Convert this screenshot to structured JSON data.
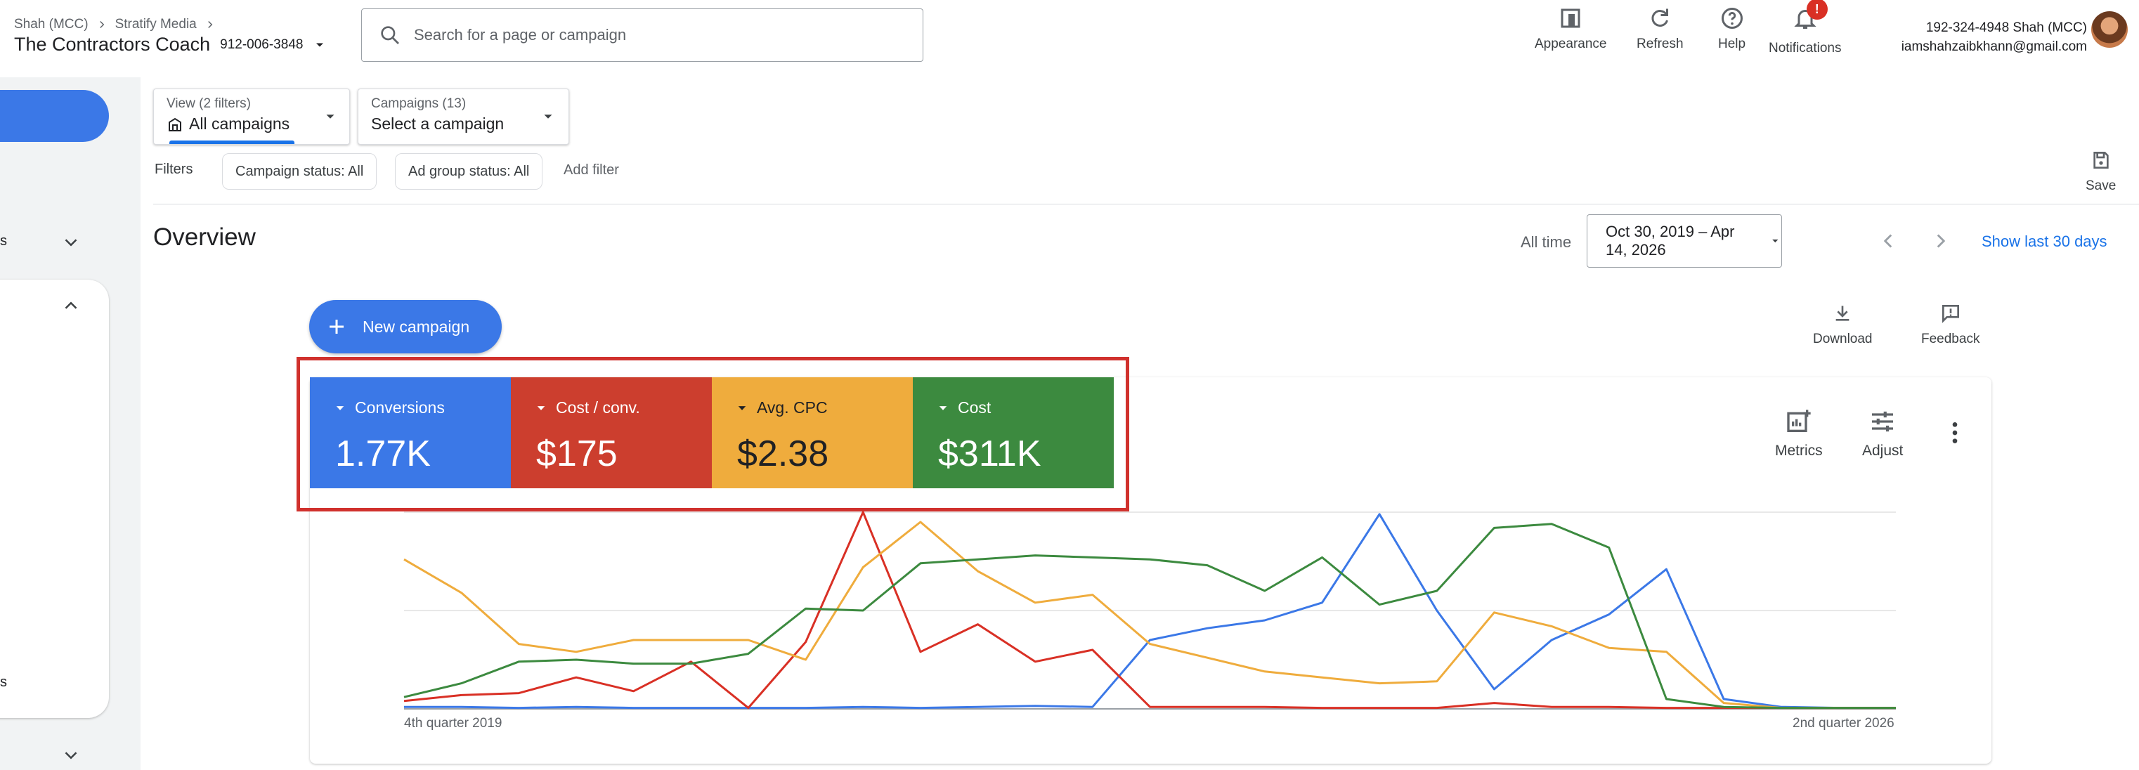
{
  "header": {
    "breadcrumb": [
      "Shah (MCC)",
      "Stratify Media"
    ],
    "account_name": "The Contractors Coach",
    "account_id": "912-006-3848",
    "search_placeholder": "Search for a page or campaign",
    "tools": {
      "appearance": "Appearance",
      "refresh": "Refresh",
      "help": "Help",
      "notifications": "Notifications",
      "notification_badge": "!"
    },
    "user": {
      "line1": "192-324-4948 Shah (MCC)",
      "email": "iamshahzaibkhann@gmail.com"
    }
  },
  "filters": {
    "view_label": "View (2 filters)",
    "view_value": "All campaigns",
    "campaigns_label": "Campaigns (13)",
    "campaigns_value": "Select a campaign",
    "filters_label": "Filters",
    "chips": [
      "Campaign status: All",
      "Ad group status: All"
    ],
    "add_filter": "Add filter",
    "save": "Save"
  },
  "overview": {
    "title": "Overview",
    "date_prefix": "All time",
    "date_range": "Oct 30, 2019 – Apr 14, 2026",
    "show_last": "Show last 30 days",
    "new_campaign": "New campaign",
    "download": "Download",
    "feedback": "Feedback",
    "metrics_btn": "Metrics",
    "adjust_btn": "Adjust"
  },
  "scorecards": [
    {
      "label": "Conversions",
      "value": "1.77K",
      "color": "#3b78e7"
    },
    {
      "label": "Cost / conv.",
      "value": "$175",
      "color": "#cc3e2e"
    },
    {
      "label": "Avg. CPC",
      "value": "$2.38",
      "color": "#efac3d"
    },
    {
      "label": "Cost",
      "value": "$311K",
      "color": "#3c8a3f"
    }
  ],
  "chart_data": {
    "type": "line",
    "x_start_label": "4th quarter 2019",
    "x_end_label": "2nd quarter 2026",
    "grid": true,
    "y_max": 100,
    "series": [
      {
        "name": "Conversions",
        "color": "#3b78e7",
        "values": [
          1,
          1,
          0.5,
          1,
          0.5,
          0.5,
          0.5,
          0.5,
          1,
          0.5,
          1,
          1.5,
          1,
          35,
          41,
          45,
          54,
          99,
          50,
          10,
          35,
          48,
          71,
          5,
          1,
          0.5,
          0.5
        ]
      },
      {
        "name": "Cost / conv.",
        "color": "#d93025",
        "values": [
          4,
          7,
          8,
          16,
          9,
          24,
          0.5,
          34,
          100,
          29,
          43,
          24,
          30,
          1,
          1,
          1,
          0.5,
          0.5,
          0.5,
          3,
          1,
          1,
          0.5,
          0.5,
          0.5,
          0.5,
          0.5
        ]
      },
      {
        "name": "Avg. CPC",
        "color": "#efac3d",
        "values": [
          76,
          59,
          33,
          29,
          35,
          35,
          35,
          25,
          72,
          95,
          70,
          54,
          58,
          33,
          26,
          19,
          16,
          13,
          14,
          49,
          42,
          31,
          29,
          3,
          0.5,
          0.5,
          0.5
        ]
      },
      {
        "name": "Cost",
        "color": "#3c8a3f",
        "values": [
          6,
          13,
          24,
          25,
          23,
          23,
          28,
          51,
          50,
          74,
          76,
          78,
          77,
          76,
          73,
          60,
          77,
          53,
          60,
          92,
          94,
          82,
          5,
          1,
          0.5,
          0.5,
          0.5
        ]
      }
    ]
  }
}
